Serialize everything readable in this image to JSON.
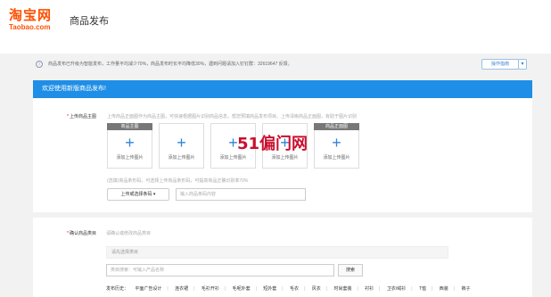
{
  "header": {
    "logo_cn": "淘宝网",
    "logo_en": "Taobao.com",
    "page_title": "商品发布"
  },
  "notice": {
    "info_icon": "i",
    "text": "商品发布已升级为智能发布，工作量平均减少70%，商品发布时长平均降低30%，遇到问题请加入钉钉群：32619647 反馈。",
    "guide_button": "操作指南",
    "guide_dropdown": "▾"
  },
  "publish": {
    "banner": "欢迎使用新版商品发布!",
    "upload_label": "上传商品主图",
    "upload_hint": "上传商品正面图作为商品主图，可快速根据图片识别商品信息，帮您预填商品发布项目。上传清晰商品正面图，有助于图片识别",
    "slots": [
      {
        "caption": "商品主图",
        "plus": "+",
        "label": "添加上传图片"
      },
      {
        "caption": "",
        "plus": "+",
        "label": "添加上传图片"
      },
      {
        "caption": "",
        "plus": "+",
        "label": "添加上传图片"
      },
      {
        "caption": "",
        "plus": "+",
        "label": "添加上传图片"
      },
      {
        "caption": "商品正面图",
        "plus": "+",
        "label": "添加上传图片"
      }
    ],
    "select_hint": "(选填)商品条形码，可选择上传商品条形码，可提高商品正确识别率70%",
    "select_button": "上传或选择条码 ▾",
    "desc_placeholder": "输入商品条码内容",
    "watermark": "51偏门网"
  },
  "category": {
    "label": "确认商品类目",
    "hint": "请确认或修改商品类目",
    "selected_placeholder": "请先选择类目",
    "search_placeholder": "类目搜索：可输入产品名称",
    "search_button": "搜索",
    "history_label": "发布历史：",
    "history_items": [
      "平面广告设计",
      "连衣裙",
      "毛衫开衫",
      "毛呢外套",
      "短外套",
      "毛衣",
      "风衣",
      "时尚套装",
      "衬衫",
      "卫衣/绒衫",
      "T恤",
      "西装",
      "裤子"
    ]
  }
}
